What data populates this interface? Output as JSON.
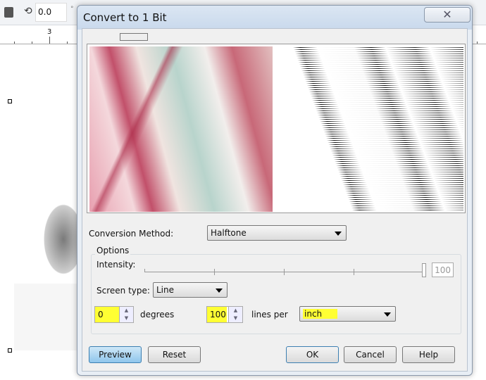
{
  "toolbar": {
    "angle_value": "0.0",
    "degree_symbol": "°"
  },
  "ruler": {
    "label": "3"
  },
  "dialog": {
    "title": "Convert to 1 Bit",
    "close_icon": "close-icon",
    "conversion_method_label": "Conversion Method:",
    "conversion_method_value": "Halftone",
    "options_label": "Options",
    "intensity_label": "Intensity:",
    "intensity_value": "100",
    "screen_type_label": "Screen type:",
    "screen_type_value": "Line",
    "angle_value": "0",
    "degrees_label": "degrees",
    "lines_value": "100",
    "lines_per_label": "lines per",
    "unit_value": "inch",
    "buttons": {
      "preview": "Preview",
      "reset": "Reset",
      "ok": "OK",
      "cancel": "Cancel",
      "help": "Help"
    }
  },
  "colors": {
    "highlight": "#ffff33",
    "preview_button": "#8fc6ec"
  }
}
